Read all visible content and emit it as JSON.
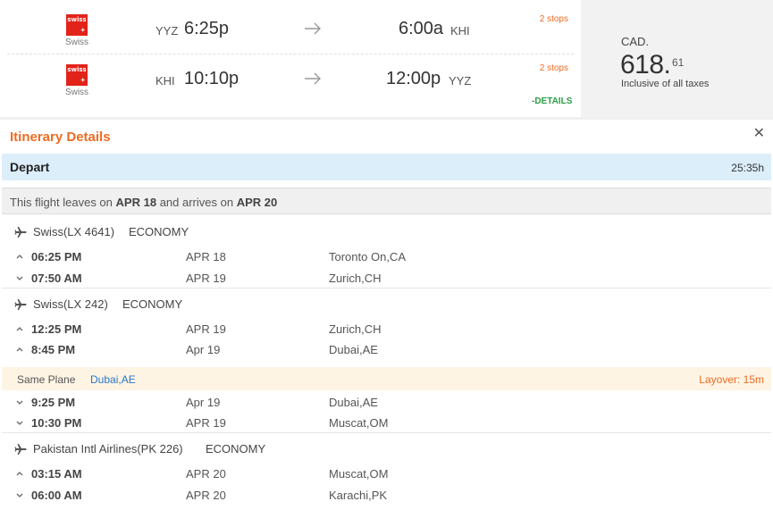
{
  "summary": {
    "legs": [
      {
        "airline": "Swiss",
        "logo_text": "swiss",
        "from_code": "YYZ",
        "depart_time": "6:25p",
        "arrive_time": "6:00a",
        "to_code": "KHI",
        "stops": "2 stops"
      },
      {
        "airline": "Swiss",
        "logo_text": "swiss",
        "from_code": "KHI",
        "depart_time": "10:10p",
        "arrive_time": "12:00p",
        "to_code": "YYZ",
        "stops": "2 stops"
      }
    ],
    "details_link": "-DETAILS",
    "price": {
      "currency": "CAD.",
      "main": "618.",
      "cents": "61",
      "note": "Inclusive of all taxes"
    }
  },
  "itinerary": {
    "title": "Itinerary Details",
    "depart_label": "Depart",
    "depart_duration": "25:35h",
    "leaves_prefix": "This flight leaves on",
    "leaves_date": "APR 18",
    "arrives_mid": "and arrives on",
    "arrives_date": "APR 20",
    "segments": [
      {
        "airline": "Swiss(LX 4641)",
        "cabin": "ECONOMY",
        "rows": [
          {
            "time": "06:25 PM",
            "date": "APR 18",
            "place": "Toronto On,CA"
          },
          {
            "time": "07:50 AM",
            "date": "APR 19",
            "place": "Zurich,CH"
          }
        ]
      },
      {
        "airline": "Swiss(LX 242)",
        "cabin": "ECONOMY",
        "rows": [
          {
            "time": "12:25 PM",
            "date": "APR 19",
            "place": "Zurich,CH"
          },
          {
            "time": "8:45 PM",
            "date": "Apr 19",
            "place": "Dubai,AE"
          }
        ]
      },
      {
        "airline": "Pakistan Intl Airlines(PK 226)",
        "cabin": "ECONOMY",
        "rows": [
          {
            "time": "03:15 AM",
            "date": "APR 20",
            "place": "Muscat,OM"
          },
          {
            "time": "06:00 AM",
            "date": "APR 20",
            "place": "Karachi,PK"
          }
        ]
      }
    ],
    "layover": {
      "label": "Same Plane",
      "city": "Dubai,AE",
      "duration": "Layover: 15m",
      "rows": [
        {
          "time": "9:25 PM",
          "date": "Apr 19",
          "place": "Dubai,AE"
        },
        {
          "time": "10:30 PM",
          "date": "APR 19",
          "place": "Muscat,OM"
        }
      ]
    }
  },
  "colors": {
    "accent_orange": "#f06b22",
    "link_green": "#2a9d44",
    "depart_blue": "#ddeefb",
    "swiss_red": "#e2231a",
    "layover_bg": "#fdf4e4",
    "city_blue": "#2a76c6"
  },
  "icons": [
    "swiss-logo",
    "arrow-right-icon",
    "close-icon",
    "plane-icon",
    "chevron-up-icon",
    "chevron-down-icon"
  ]
}
